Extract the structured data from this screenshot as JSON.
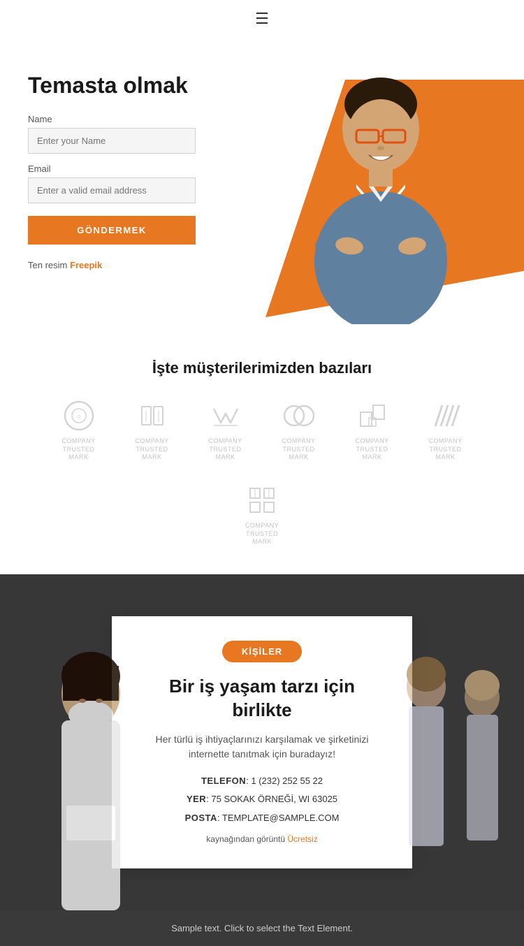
{
  "header": {
    "menu_icon": "☰"
  },
  "hero": {
    "title": "Temasta olmak",
    "name_label": "Name",
    "name_placeholder": "Enter your Name",
    "email_label": "Email",
    "email_placeholder": "Enter a valid email address",
    "submit_label": "GÖNDERMEK",
    "credit_prefix": "Ten resim",
    "credit_link_text": "Freepik",
    "credit_href": "#"
  },
  "clients": {
    "title": "İşte müşterilerimizden bazıları",
    "logos": [
      {
        "id": "logo-1",
        "label": "COMPANY\nTRUSTED MARK"
      },
      {
        "id": "logo-2",
        "label": "COMPANY\nTRUSTED MARK"
      },
      {
        "id": "logo-3",
        "label": "COMPANY\nTRUSTED MARK"
      },
      {
        "id": "logo-4",
        "label": "COMPANY\nTRUSTED MARK"
      },
      {
        "id": "logo-5",
        "label": "COMPANY\nTRUSTED MARK"
      },
      {
        "id": "logo-6",
        "label": "COMPANY\nTRUSTED MARK"
      },
      {
        "id": "logo-7",
        "label": "COMPANY\nTRUSTED MARK"
      }
    ]
  },
  "team": {
    "badge_label": "KİŞİLER",
    "title": "Bir iş yaşam tarzı için birlikte",
    "description": "Her türlü iş ihtiyaçlarınızı karşılamak ve şirketinizi internette tanıtmak için buradayız!",
    "telefon_label": "TELEFON",
    "telefon_value": "1 (232) 252 55 22",
    "yer_label": "YER",
    "yer_value": "75 SOKAK ÖRNEĞİ, WI 63025",
    "posta_label": "POSTA",
    "posta_value": "TEMPLATE@SAMPLE.COM",
    "credit_prefix": "kaynağından görüntü",
    "credit_link_text": "Ücretsiz",
    "credit_href": "#"
  },
  "footer": {
    "text": "Sample text. Click to select the Text Element."
  },
  "colors": {
    "accent": "#e87722",
    "dark": "#1a1a1a",
    "gray": "#555555"
  }
}
